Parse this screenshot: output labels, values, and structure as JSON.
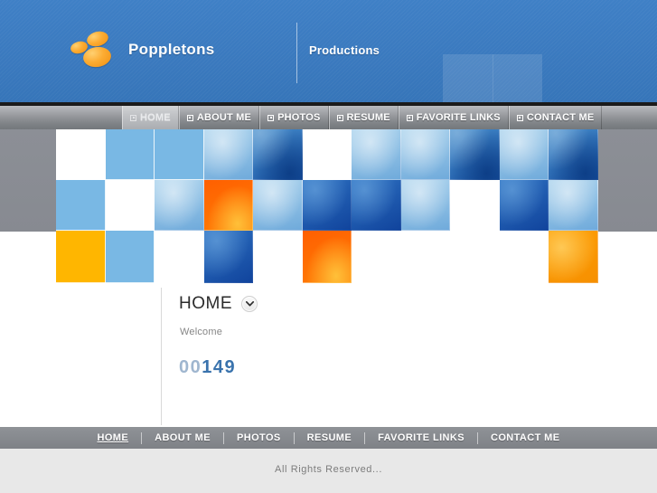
{
  "site": {
    "brand_name": "Poppletons",
    "brand_subtitle": "Productions",
    "logo_icon": "three-orange-ellipses-logo"
  },
  "colors": {
    "header_blue": "#3a7bc0",
    "nav_gray": "#8d9094",
    "footer_gray": "#878a8f",
    "accent_orange": "#ffb600",
    "tile_light_blue": "#79b8e4",
    "tile_dark_blue": "#1d61b8",
    "counter_blue": "#3a73ad",
    "counter_lead_blue": "#9fb6cf",
    "copyright_bg": "#e8e8e8"
  },
  "nav": {
    "bullet_icon": "square-bullet-icon",
    "items": [
      {
        "label": "HOME",
        "active": true
      },
      {
        "label": "ABOUT ME",
        "active": false
      },
      {
        "label": "PHOTOS",
        "active": false
      },
      {
        "label": "RESUME",
        "active": false
      },
      {
        "label": "FAVORITE LINKS",
        "active": false
      },
      {
        "label": "CONTACT ME",
        "active": false
      }
    ]
  },
  "banner": {
    "mosaic_rows": [
      [
        "white",
        "lightblue",
        "lightblue",
        "photo-light",
        "photo-dark",
        "white",
        "photo-light",
        "photo-light",
        "photo-dark",
        "photo-light",
        "photo-dark"
      ],
      [
        "lightblue",
        "white",
        "photo-light",
        "orange",
        "photo-light",
        "photo-deep",
        "photo-deep",
        "photo-light",
        "white",
        "photo-deep",
        "photo-light"
      ],
      [
        "orange",
        "lightblue",
        "white",
        "photo-deep",
        "white",
        "deeporange",
        "white",
        "white",
        "white",
        "white",
        "amber"
      ]
    ]
  },
  "content": {
    "page_title": "HOME",
    "toggle_icon": "chevron-down-circle-icon",
    "welcome_text": "Welcome",
    "hit_counter": {
      "leading": "00",
      "value": "149",
      "full": "00149"
    }
  },
  "footer": {
    "links": [
      {
        "label": "HOME",
        "current": true
      },
      {
        "label": "ABOUT ME",
        "current": false
      },
      {
        "label": "PHOTOS",
        "current": false
      },
      {
        "label": "RESUME",
        "current": false
      },
      {
        "label": "FAVORITE LINKS",
        "current": false
      },
      {
        "label": "CONTACT ME",
        "current": false
      }
    ],
    "copyright": "All Rights Reserved..."
  }
}
